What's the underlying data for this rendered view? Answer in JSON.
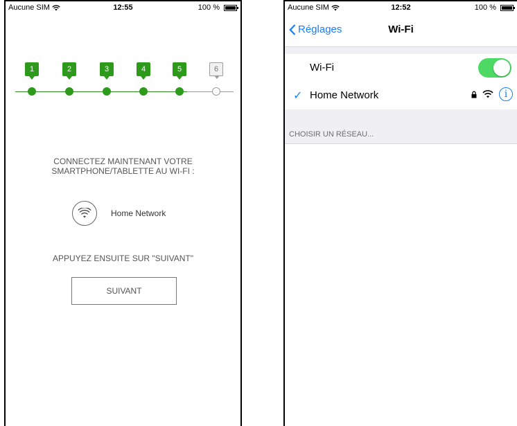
{
  "left_phone": {
    "status": {
      "carrier": "Aucune SIM",
      "time": "12:55",
      "battery": "100 %"
    },
    "steps": [
      {
        "label": "1",
        "active": true
      },
      {
        "label": "2",
        "active": true
      },
      {
        "label": "3",
        "active": true
      },
      {
        "label": "4",
        "active": true
      },
      {
        "label": "5",
        "active": true
      },
      {
        "label": "6",
        "active": false
      }
    ],
    "instruction_line1": "CONNECTEZ MAINTENANT VOTRE",
    "instruction_line2": "SMARTPHONE/TABLETTE AU WI-FI :",
    "network_name": "Home Network",
    "instruction_next": "APPUYEZ ENSUITE SUR \"SUIVANT\"",
    "next_button": "SUIVANT"
  },
  "right_phone": {
    "status": {
      "carrier": "Aucune SIM",
      "time": "12:52",
      "battery": "100 %"
    },
    "back_label": "Réglages",
    "title": "Wi-Fi",
    "wifi_label": "Wi-Fi",
    "wifi_enabled": true,
    "connected_network": "Home Network",
    "section_header": "CHOISIR UN RÉSEAU..."
  },
  "colors": {
    "step_green": "#2e9a1c",
    "ios_blue": "#1a7ef7",
    "toggle_green": "#4cd964"
  }
}
